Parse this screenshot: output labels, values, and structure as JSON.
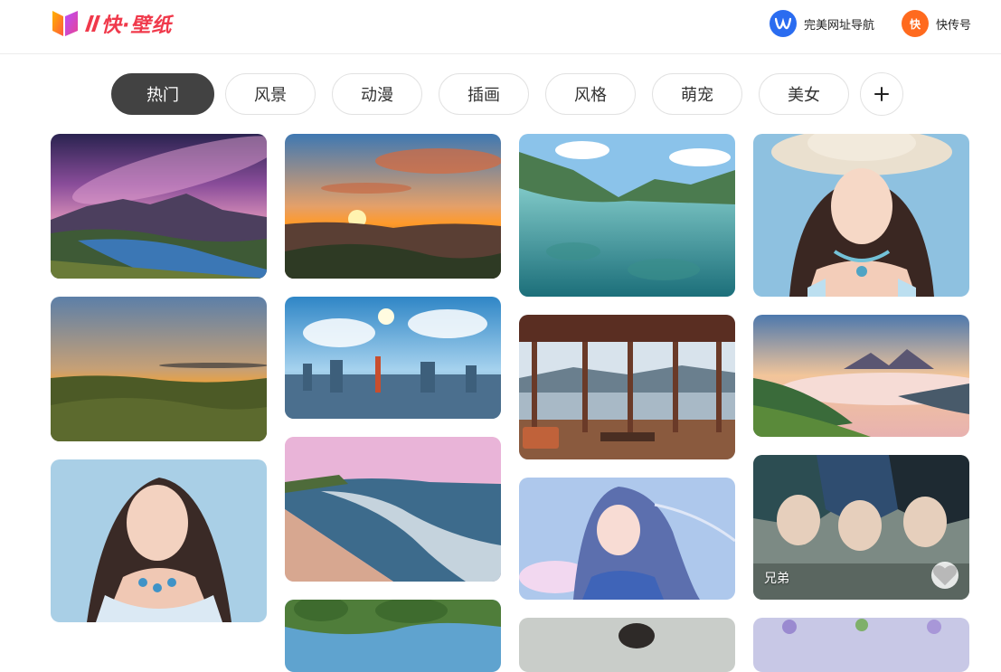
{
  "header": {
    "logo_text": "快·壁纸",
    "links": [
      {
        "label": "完美网址导航",
        "icon": "w-icon",
        "color": "#2a6cf0"
      },
      {
        "label": "快传号",
        "icon": "kuai-icon",
        "color": "#ff6a1e",
        "glyph": "快"
      }
    ]
  },
  "tabs": [
    {
      "label": "热门",
      "active": true
    },
    {
      "label": "风景"
    },
    {
      "label": "动漫"
    },
    {
      "label": "插画"
    },
    {
      "label": "风格"
    },
    {
      "label": "萌宠"
    },
    {
      "label": "美女"
    }
  ],
  "cards": [
    {
      "subject": "galaxy-lake-landscape"
    },
    {
      "subject": "sunset-clouds-valley"
    },
    {
      "subject": "clear-water-mountains"
    },
    {
      "subject": "woman-with-hat"
    },
    {
      "subject": "sunset-grassland"
    },
    {
      "subject": "sunlit-city-skyline"
    },
    {
      "subject": "lakeside-pavilion"
    },
    {
      "subject": "misty-mountain-sunrise"
    },
    {
      "subject": "woman-blue-top"
    },
    {
      "subject": "pink-beach-coast"
    },
    {
      "subject": "anime-girl-blue"
    },
    {
      "subject": "anime-brothers",
      "caption": "兄弟"
    },
    {
      "subject": "tropical-coast"
    },
    {
      "subject": "portrait-partial"
    },
    {
      "subject": "flowers-partial"
    }
  ],
  "colors": {
    "accent": "#f0394b",
    "tab_active_bg": "#424242"
  }
}
